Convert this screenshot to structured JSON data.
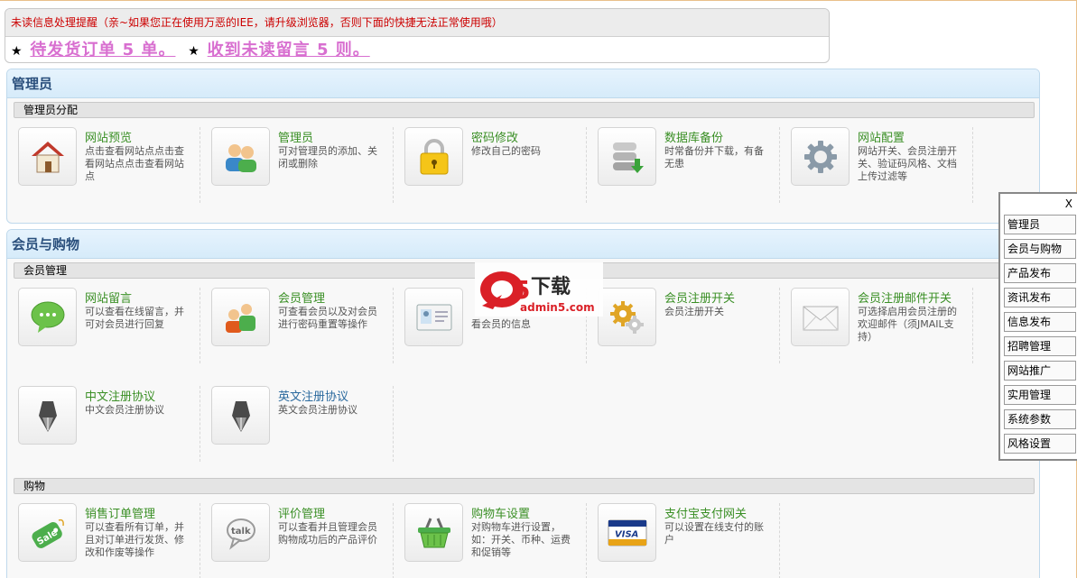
{
  "notice": {
    "title": "未读信息处理提醒（亲~如果您正在使用万恶的IEE，请升级浏览器，否则下面的快捷无法正常使用哦）",
    "star": "★",
    "pending_orders": "待发货订单 5 单。",
    "unread_messages": "收到未读留言 5 则。"
  },
  "admin_panel": {
    "title": "管理员",
    "sections": [
      {
        "name": "管理员分配",
        "items": [
          {
            "title": "网站预览",
            "desc": "点击查看网站点点击查看网站点点击查看网站点",
            "icon": "home-icon"
          },
          {
            "title": "管理员",
            "desc": "可对管理员的添加、关闭或删除",
            "icon": "users-icon"
          },
          {
            "title": "密码修改",
            "desc": "修改自己的密码",
            "icon": "lock-icon"
          },
          {
            "title": "数据库备份",
            "desc": "时常备份并下载，有备无患",
            "icon": "database-icon"
          },
          {
            "title": "网站配置",
            "desc": "网站开关、会员注册开关、验证码风格、文档上传过滤等",
            "icon": "gear-icon"
          }
        ]
      }
    ]
  },
  "member_panel": {
    "title": "会员与购物",
    "sections": [
      {
        "name": "会员管理",
        "items": [
          {
            "title": "网站留言",
            "desc": "可以查看在线留言，并可对会员进行回复",
            "icon": "chat-bubble-icon"
          },
          {
            "title": "会员管理",
            "desc": "可查看会员以及对会员进行密码重置等操作",
            "icon": "members-icon"
          },
          {
            "title": "",
            "desc": "看会员的信息",
            "icon": "id-card-icon"
          },
          {
            "title": "会员注册开关",
            "desc": "会员注册开关",
            "icon": "gears-icon"
          },
          {
            "title": "会员注册邮件开关",
            "desc": "可选择启用会员注册的欢迎邮件（须JMAIL支持）",
            "icon": "envelope-icon"
          },
          {
            "title": "中文注册协议",
            "desc": "中文会员注册协议",
            "icon": "pen-icon"
          },
          {
            "title": "英文注册协议",
            "desc": "英文会员注册协议",
            "icon": "pen-icon"
          }
        ]
      },
      {
        "name": "购物",
        "items": [
          {
            "title": "销售订单管理",
            "desc": "可以查看所有订单，并且对订单进行发货、修改和作废等操作",
            "icon": "sale-tag-icon"
          },
          {
            "title": "评价管理",
            "desc": "可以查看并且管理会员购物成功后的产品评价",
            "icon": "talk-icon"
          },
          {
            "title": "购物车设置",
            "desc": "对购物车进行设置，如：开关、币种、运费和促销等",
            "icon": "basket-icon"
          },
          {
            "title": "支付宝支付网关",
            "desc": "可以设置在线支付的账户",
            "icon": "visa-card-icon"
          }
        ]
      }
    ]
  },
  "side_menu": {
    "close": "X",
    "items": [
      "管理员",
      "会员与购物",
      "产品发布",
      "资讯发布",
      "信息发布",
      "招聘管理",
      "网站推广",
      "实用管理",
      "系统参数",
      "风格设置"
    ]
  },
  "watermark": {
    "logo_text": "a5下载",
    "site": "admin5.com"
  }
}
